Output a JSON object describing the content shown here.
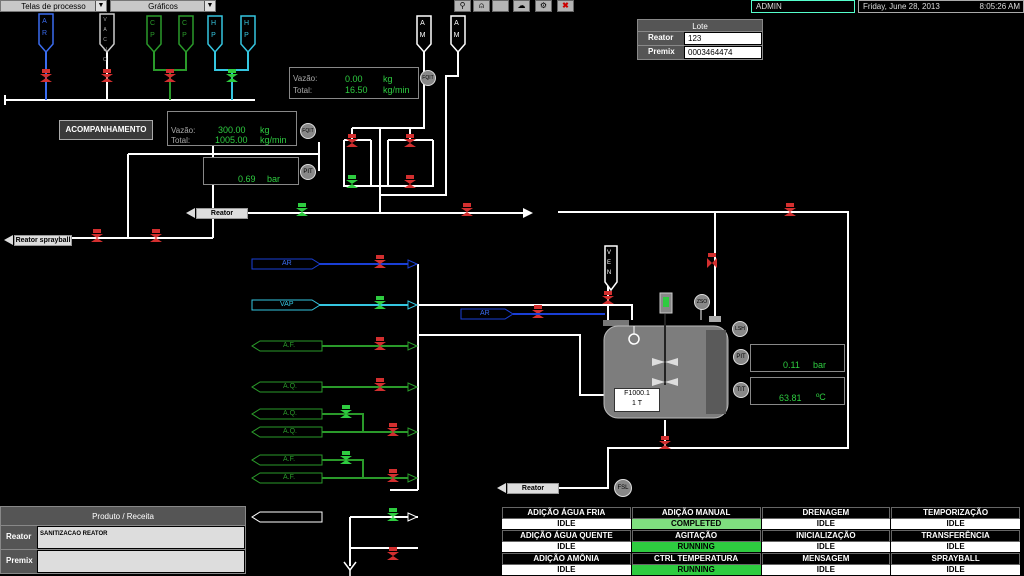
{
  "toolbar": {
    "menu1": "Telas de processo",
    "menu2": "Gráficos",
    "icons": [
      "binoculars-icon",
      "bell-icon",
      "blank-icon",
      "cloud-icon",
      "settings-icon",
      "close-icon"
    ]
  },
  "header": {
    "user": "ADMIN",
    "date": "Friday, June 28, 2013",
    "time": "8:05:26 AM"
  },
  "lote": {
    "title": "Lote",
    "reator_label": "Reator",
    "reator_value": "123",
    "premix_label": "Premix",
    "premix_value": "0003464474"
  },
  "supply_lines": [
    "A R",
    "V A C U O",
    "C P",
    "C P",
    "H P",
    "H P",
    "A M",
    "A M"
  ],
  "flow_top": {
    "vazao_label": "Vazão:",
    "vazao_value": "0.00",
    "vazao_unit": "kg",
    "total_label": "Total:",
    "total_value": "16.50",
    "total_unit": "kg/min",
    "instrument": "FQIT"
  },
  "flow_left": {
    "vazao_label": "Vazão:",
    "vazao_value": "300.00",
    "vazao_unit": "kg",
    "total_label": "Total:",
    "total_value": "1005.00",
    "total_unit": "kg/min",
    "instrument": "FQIT"
  },
  "pressure_top": {
    "value": "0.69",
    "unit": "bar",
    "instrument": "PIT"
  },
  "acompanhamento": "ACOMPANHAMENTO",
  "destinations": {
    "reator_top": "Reator",
    "reator_sprayball": "Reator sprayball",
    "reator_bottom": "Reator"
  },
  "inlets": [
    "AR",
    "VAP",
    "A.F.",
    "A.Q.",
    "A.Q.",
    "A.Q.",
    "A.F.",
    "A.F.",
    "AR"
  ],
  "vent": "V E N",
  "tank": {
    "id": "F1000.1",
    "capacity": "1 T",
    "instruments": [
      "ZSO",
      "LSH",
      "PIT",
      "TIT",
      "FSL"
    ]
  },
  "tank_pressure": {
    "value": "0.11",
    "unit": "bar"
  },
  "tank_temperature": {
    "value": "63.81",
    "unit": "ºC"
  },
  "produto": {
    "title": "Produto / Receita",
    "reator_label": "Reator",
    "reator_value": "SANITIZACAO REATOR",
    "premix_label": "Premix",
    "premix_value": ""
  },
  "statuses": [
    {
      "name": "ADIÇÃO ÁGUA FRIA",
      "value": "IDLE",
      "state": "idle"
    },
    {
      "name": "ADIÇÃO MANUAL",
      "value": "COMPLETED",
      "state": "done"
    },
    {
      "name": "DRENAGEM",
      "value": "IDLE",
      "state": "idle"
    },
    {
      "name": "TEMPORIZAÇÃO",
      "value": "IDLE",
      "state": "idle"
    },
    {
      "name": "ADIÇÃO ÁGUA QUENTE",
      "value": "IDLE",
      "state": "idle"
    },
    {
      "name": "AGITAÇÃO",
      "value": "RUNNING",
      "state": "on"
    },
    {
      "name": "INICIALIZAÇÃO",
      "value": "IDLE",
      "state": "idle"
    },
    {
      "name": "TRANSFERÊNCIA",
      "value": "IDLE",
      "state": "idle"
    },
    {
      "name": "ADIÇÃO AMÔNIA",
      "value": "IDLE",
      "state": "idle"
    },
    {
      "name": "CTRL TEMPERATURA",
      "value": "RUNNING",
      "state": "on"
    },
    {
      "name": "MENSAGEM",
      "value": "IDLE",
      "state": "idle"
    },
    {
      "name": "SPRAYBALL",
      "value": "IDLE",
      "state": "idle"
    }
  ],
  "colors": {
    "pipe": "#ffffff",
    "valve_closed": "#d32f2f",
    "valve_open": "#2ecc40",
    "air": "#1a3fd6",
    "steam": "#35c6e0",
    "water": "#2a9a2a",
    "running": "#2ecc40"
  }
}
